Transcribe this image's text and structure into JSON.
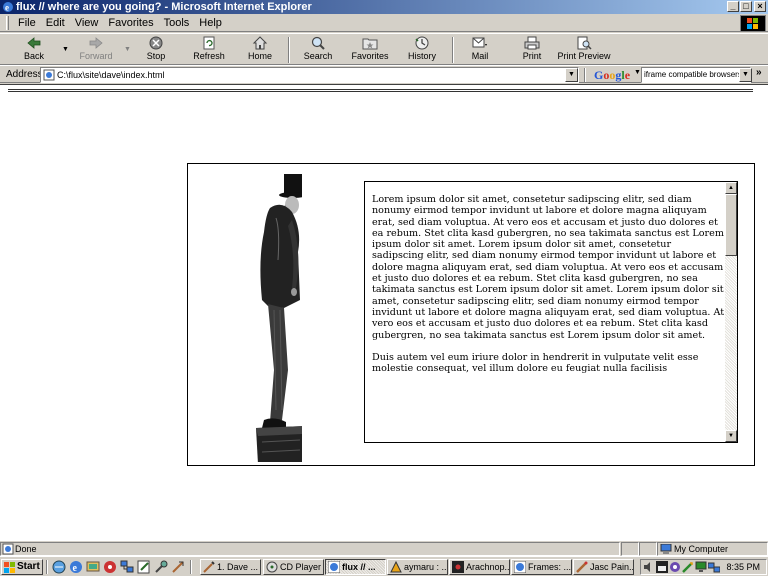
{
  "window": {
    "title": "flux // where are you going? - Microsoft Internet Explorer",
    "controls": [
      "minimize",
      "maximize",
      "close"
    ]
  },
  "menu": {
    "items": [
      "File",
      "Edit",
      "View",
      "Favorites",
      "Tools",
      "Help"
    ]
  },
  "toolbar": {
    "back": "Back",
    "forward": "Forward",
    "stop": "Stop",
    "refresh": "Refresh",
    "home": "Home",
    "search": "Search",
    "favorites": "Favorites",
    "history": "History",
    "mail": "Mail",
    "print": "Print",
    "print_preview": "Print Preview"
  },
  "address": {
    "label": "Address",
    "url": "C:\\flux\\site\\dave\\index.html"
  },
  "google": {
    "logo": "Google",
    "query": "iframe compatible browsers"
  },
  "content": {
    "paragraphs": [
      "Lorem ipsum dolor sit amet, consetetur sadipscing elitr, sed diam nonumy eirmod tempor invidunt ut labore et dolore magna aliquyam erat, sed diam voluptua. At vero eos et accusam et justo duo dolores et ea rebum. Stet clita kasd gubergren, no sea takimata sanctus est Lorem ipsum dolor sit amet. Lorem ipsum dolor sit amet, consetetur sadipscing elitr, sed diam nonumy eirmod tempor invidunt ut labore et dolore magna aliquyam erat, sed diam voluptua. At vero eos et accusam et justo duo dolores et ea rebum. Stet clita kasd gubergren, no sea takimata sanctus est Lorem ipsum dolor sit amet. Lorem ipsum dolor sit amet, consetetur sadipscing elitr, sed diam nonumy eirmod tempor invidunt ut labore et dolore magna aliquyam erat, sed diam voluptua. At vero eos et accusam et justo duo dolores et ea rebum. Stet clita kasd gubergren, no sea takimata sanctus est Lorem ipsum dolor sit amet.",
      "Duis autem vel eum iriure dolor in hendrerit in vulputate velit esse molestie consequat, vel illum dolore eu feugiat nulla facilisis"
    ]
  },
  "status": {
    "text": "Done",
    "zone": "My Computer"
  },
  "taskbar": {
    "start": "Start",
    "quicklaunch_icons": [
      "ie-icon",
      "ie-icon",
      "desktop-icon",
      "media-icon",
      "tool-icon",
      "app-icon",
      "app-icon",
      "app-icon"
    ],
    "tasks": [
      "1. Dave ...",
      "CD Player",
      "flux // ...",
      "aymaru : ...",
      "Arachnop...",
      "Frames: ...",
      "Jasc Pain..."
    ],
    "active_task_index": 2,
    "clock": "8:35 PM"
  },
  "colors": {
    "title_start": "#0a246a",
    "title_end": "#a6caf0",
    "chrome": "#d4d0c8"
  }
}
